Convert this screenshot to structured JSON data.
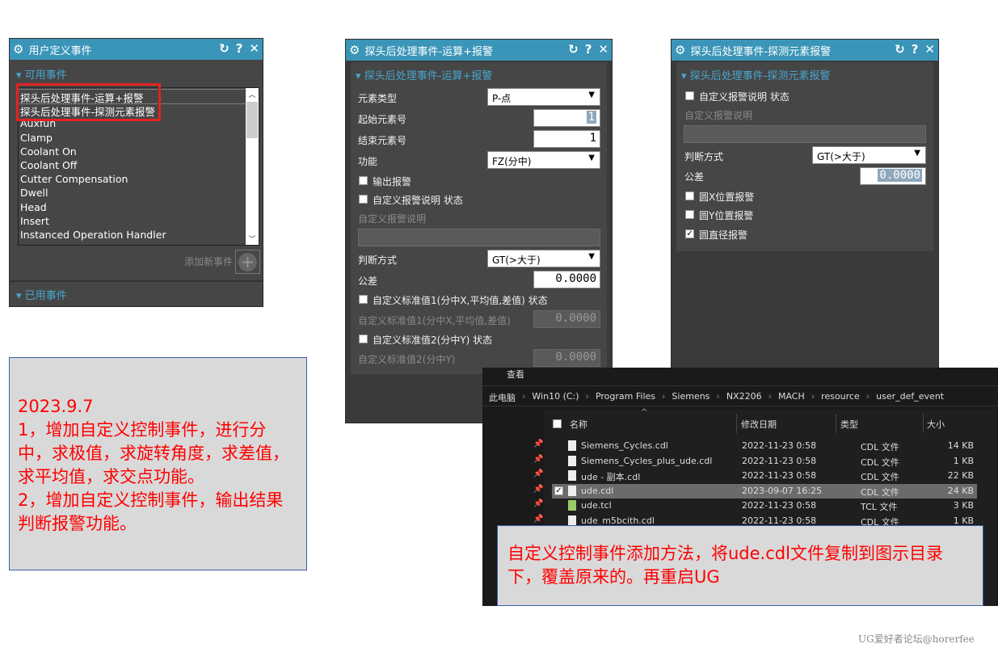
{
  "panel1": {
    "title": "用户定义事件",
    "section_available": "可用事件",
    "items": [
      "探头后处理事件-运算+报警",
      "探头后处理事件-探测元素报警",
      "Auxfun",
      "Clamp",
      "Coolant On",
      "Coolant Off",
      "Cutter Compensation",
      "Dwell",
      "Head",
      "Insert",
      "Instanced Operation Handler"
    ],
    "add_label": "添加新事件",
    "section_used": "已用事件"
  },
  "panel2": {
    "title": "探头后处理事件-运算+报警",
    "section": "探头后处理事件-运算+报警",
    "elem_type_label": "元素类型",
    "elem_type": "P-点",
    "start_label": "起始元素号",
    "start": "1",
    "end_label": "结束元素号",
    "end": "1",
    "func_label": "功能",
    "func": "FZ(分中)",
    "out_alarm": "输出报警",
    "custom_state": "自定义报警说明 状态",
    "custom_desc": "自定义报警说明",
    "judge_label": "判断方式",
    "judge": "GT(>大于)",
    "tol_label": "公差",
    "tol": "0.0000",
    "std1_state": "自定义标准值1(分中X,平均值,差值) 状态",
    "std1_label": "自定义标准值1(分中X,平均值,差值)",
    "std1": "0.0000",
    "std2_state": "自定义标准值2(分中Y) 状态",
    "std2_label": "自定义标准值2(分中Y)",
    "std2": "0.0000"
  },
  "panel3": {
    "title": "探头后处理事件-探测元素报警",
    "section": "探头后处理事件-探测元素报警",
    "custom_state": "自定义报警说明 状态",
    "custom_desc": "自定义报警说明",
    "judge_label": "判断方式",
    "judge": "GT(>大于)",
    "tol_label": "公差",
    "tol": "0.0000",
    "cx": "圆X位置报警",
    "cy": "圆Y位置报警",
    "cd": "圆直径报警"
  },
  "note1": [
    "2023.9.7",
    "1，增加自定义控制事件，进行分中，求极值，求旋转角度，求差值，求平均值，求交点功能。",
    "2，增加自定义控制事件，输出结果判断报警功能。"
  ],
  "explorer": {
    "menu": "查看",
    "path": [
      "此电脑",
      "Win10 (C:)",
      "Program Files",
      "Siemens",
      "NX2206",
      "MACH",
      "resource",
      "user_def_event"
    ],
    "headers": [
      "名称",
      "修改日期",
      "类型",
      "大小"
    ],
    "rows": [
      [
        "Siemens_Cycles.cdl",
        "2022-11-23 0:58",
        "CDL 文件",
        "14 KB"
      ],
      [
        "Siemens_Cycles_plus_ude.cdl",
        "2022-11-23 0:58",
        "CDL 文件",
        "1 KB"
      ],
      [
        "ude - 副本.cdl",
        "2022-11-23 0:58",
        "CDL 文件",
        "22 KB"
      ],
      [
        "ude.cdl",
        "2023-09-07 16:25",
        "CDL 文件",
        "24 KB"
      ],
      [
        "ude.tcl",
        "2022-11-23 0:58",
        "TCL 文件",
        "3 KB"
      ],
      [
        "ude_m5bcith.cdl",
        "2022-11-23 0:58",
        "CDL 文件",
        "1 KB"
      ]
    ]
  },
  "note2": "自定义控制事件添加方法，将ude.cdl文件复制到图示目录下，覆盖原来的。再重启UG",
  "watermark": "UG爱好者论坛@horerfee"
}
